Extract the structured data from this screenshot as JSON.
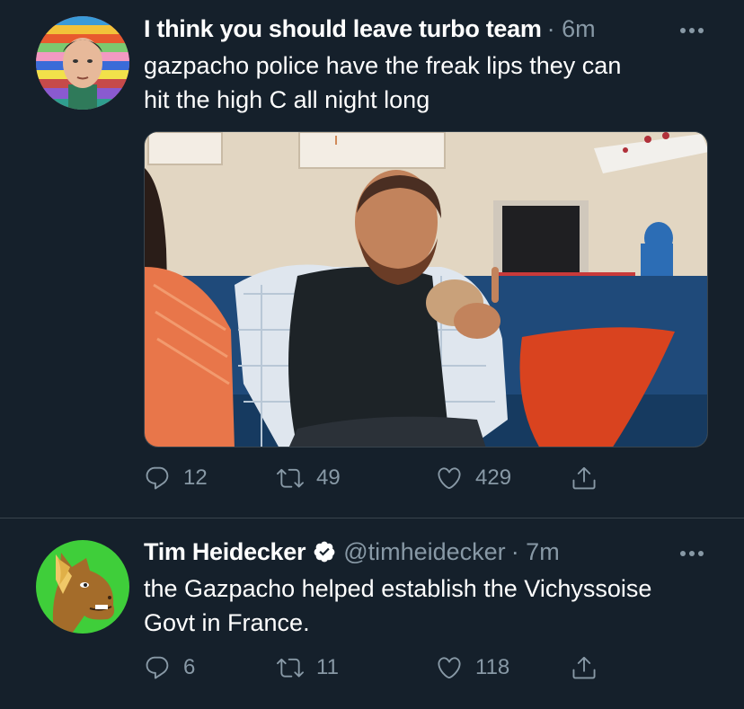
{
  "tweets": [
    {
      "display_name": "I think you should leave turbo team",
      "time": "· 6m",
      "text": "gazpacho police have the freak lips they can\nhit the high C all night long",
      "replies": "12",
      "retweets": "49",
      "likes": "429"
    },
    {
      "display_name": "Tim Heidecker",
      "handle": "@timheidecker",
      "time": "· 7m",
      "text": "the Gazpacho helped establish the Vichyssoise\nGovt in France.",
      "replies": "6",
      "retweets": "11",
      "likes": "118"
    }
  ],
  "colors": {
    "background": "#15202b",
    "secondary_text": "#8899a6",
    "divider": "#38444d",
    "verified_badge": "#ffffff"
  },
  "icons": [
    "more-icon",
    "reply-icon",
    "retweet-icon",
    "like-icon",
    "share-icon",
    "verified-icon"
  ]
}
